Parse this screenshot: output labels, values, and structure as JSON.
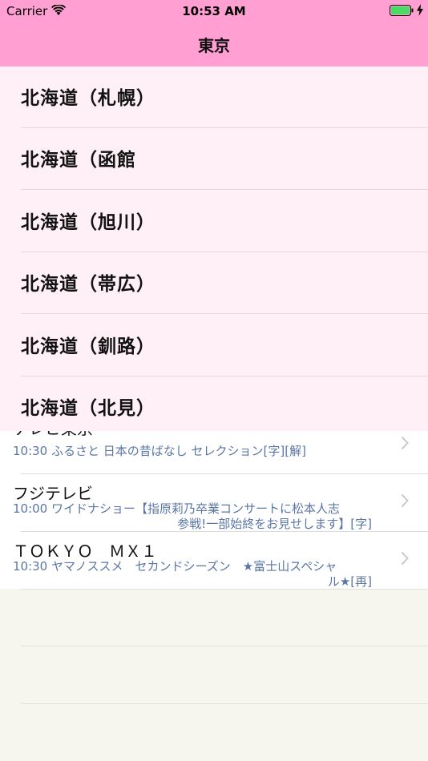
{
  "status_bar": {
    "carrier": "Carrier",
    "time": "10:53 AM",
    "icons": [
      "wifi-icon",
      "battery-icon",
      "charge-icon"
    ],
    "battery_color": "#4cd964"
  },
  "nav": {
    "title": "東京",
    "bar_color": "#ff9fd2"
  },
  "dropdown": {
    "items": [
      {
        "label": "北海道（札幌）"
      },
      {
        "label": "北海道（函館"
      },
      {
        "label": "北海道（旭川）"
      },
      {
        "label": "北海道（帯広）"
      },
      {
        "label": "北海道（釧路）"
      },
      {
        "label": "北海道（北見）"
      }
    ]
  },
  "programs": [
    {
      "channel": "テレビ東京",
      "line1": "10:30 ふるさと 日本の昔ばなし セレクション[字][解]",
      "line2": ""
    },
    {
      "channel": "フジテレビ",
      "line1": "10:00 ワイドナショー【指原莉乃卒業コンサートに松本人志",
      "line2": "参戦!一部始終をお見せします】[字]"
    },
    {
      "channel": "ＴＯＫＹＯ　ＭＸ１",
      "line1": "10:30 ヤマノススメ　セカンドシーズン　★富士山スペシャ",
      "line2": "ル★[再]"
    }
  ],
  "colors": {
    "program_text": "#5a76a6",
    "dropdown_bg": "#fff0f7"
  }
}
